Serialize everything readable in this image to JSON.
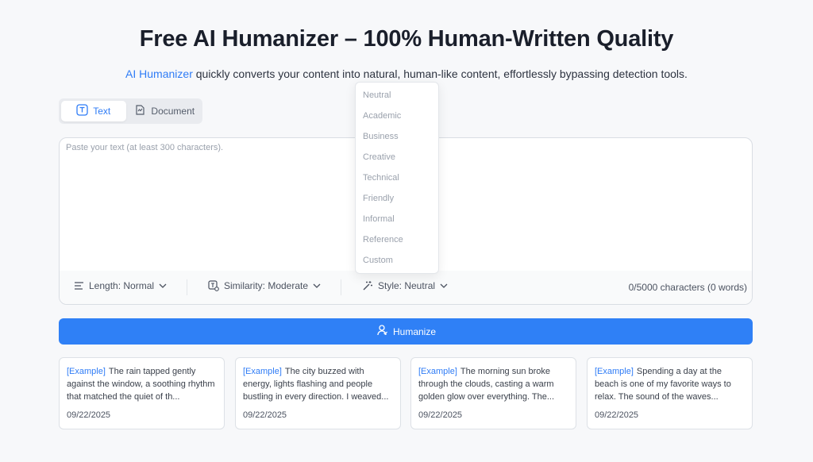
{
  "header": {
    "title": "Free AI Humanizer – 100% Human-Written Quality",
    "subtitle_link": "AI Humanizer",
    "subtitle_rest": "quickly converts your content into natural, human-like content, effortlessly bypassing detection tools."
  },
  "mode_tabs": [
    {
      "label": "Text",
      "active": true
    },
    {
      "label": "Document",
      "active": false
    }
  ],
  "editor": {
    "placeholder": "Paste your text (at least 300 characters).",
    "value": ""
  },
  "toolbar": {
    "length_label": "Length: Normal",
    "similarity_label": "Similarity: Moderate",
    "style_label": "Style: Neutral",
    "char_count": "0/5000 characters (0 words)"
  },
  "style_menu": {
    "options": [
      "Neutral",
      "Academic",
      "Business",
      "Creative",
      "Technical",
      "Friendly",
      "Informal",
      "Reference",
      "Custom"
    ]
  },
  "humanize_button": "Humanize",
  "examples": [
    {
      "tag": "[Example]",
      "text": "The rain tapped gently against the window, a soothing rhythm that matched the quiet of th...",
      "date": "09/22/2025"
    },
    {
      "tag": "[Example]",
      "text": "The city buzzed with energy, lights flashing and people bustling in every direction. I weaved...",
      "date": "09/22/2025"
    },
    {
      "tag": "[Example]",
      "text": "The morning sun broke through the clouds, casting a warm golden glow over everything. The...",
      "date": "09/22/2025"
    },
    {
      "tag": "[Example]",
      "text": "Spending a day at the beach is one of my favorite ways to relax. The sound of the waves...",
      "date": "09/22/2025"
    }
  ],
  "colors": {
    "accent": "#2f80f6",
    "link": "#2f7cf6",
    "background": "#f7f8fa"
  }
}
